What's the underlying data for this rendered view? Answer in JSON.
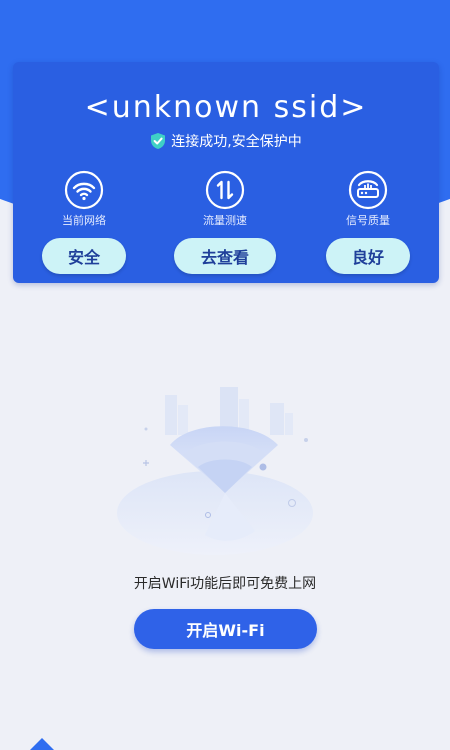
{
  "header": {
    "ssid": "<unknown ssid>",
    "status": "连接成功,安全保护中",
    "status_icon": "shield-check-icon"
  },
  "metrics": [
    {
      "label": "当前网络",
      "value": "安全",
      "icon": "wifi-icon"
    },
    {
      "label": "流量测速",
      "value": "去查看",
      "icon": "speed-arrows-icon"
    },
    {
      "label": "信号质量",
      "value": "良好",
      "icon": "signal-router-icon"
    }
  ],
  "main": {
    "hint": "开启WiFi功能后即可免费上网",
    "button_label": "开启Wi-Fi"
  },
  "colors": {
    "primary": "#2f6df0",
    "card": "#2a5fe2",
    "pill": "#cdf3f7",
    "background": "#eef0f7"
  }
}
